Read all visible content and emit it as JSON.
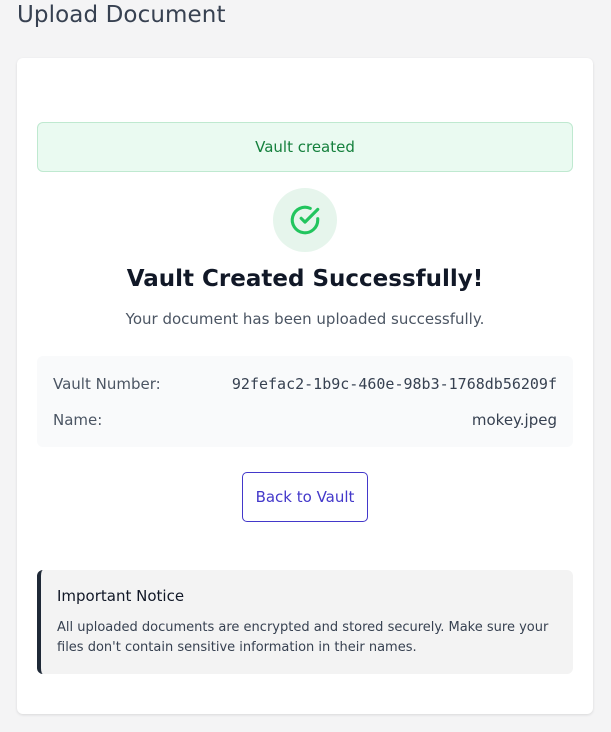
{
  "page": {
    "title": "Upload Document"
  },
  "alert": {
    "text": "Vault created"
  },
  "success": {
    "icon": "check-circle-icon",
    "title": "Vault Created Successfully!",
    "subtitle": "Your document has been uploaded successfully."
  },
  "details": {
    "vault_number_label": "Vault Number:",
    "vault_number_value": "92fefac2-1b9c-460e-98b3-1768db56209f",
    "name_label": "Name:",
    "name_value": "mokey.jpeg"
  },
  "actions": {
    "back_label": "Back to Vault"
  },
  "notice": {
    "title": "Important Notice",
    "body": "All uploaded documents are encrypted and stored securely. Make sure your files don't contain sensitive information in their names."
  },
  "colors": {
    "success_green": "#22c55e",
    "alert_text": "#15803d",
    "primary": "#4338ca",
    "notice_border": "#1f2937"
  }
}
